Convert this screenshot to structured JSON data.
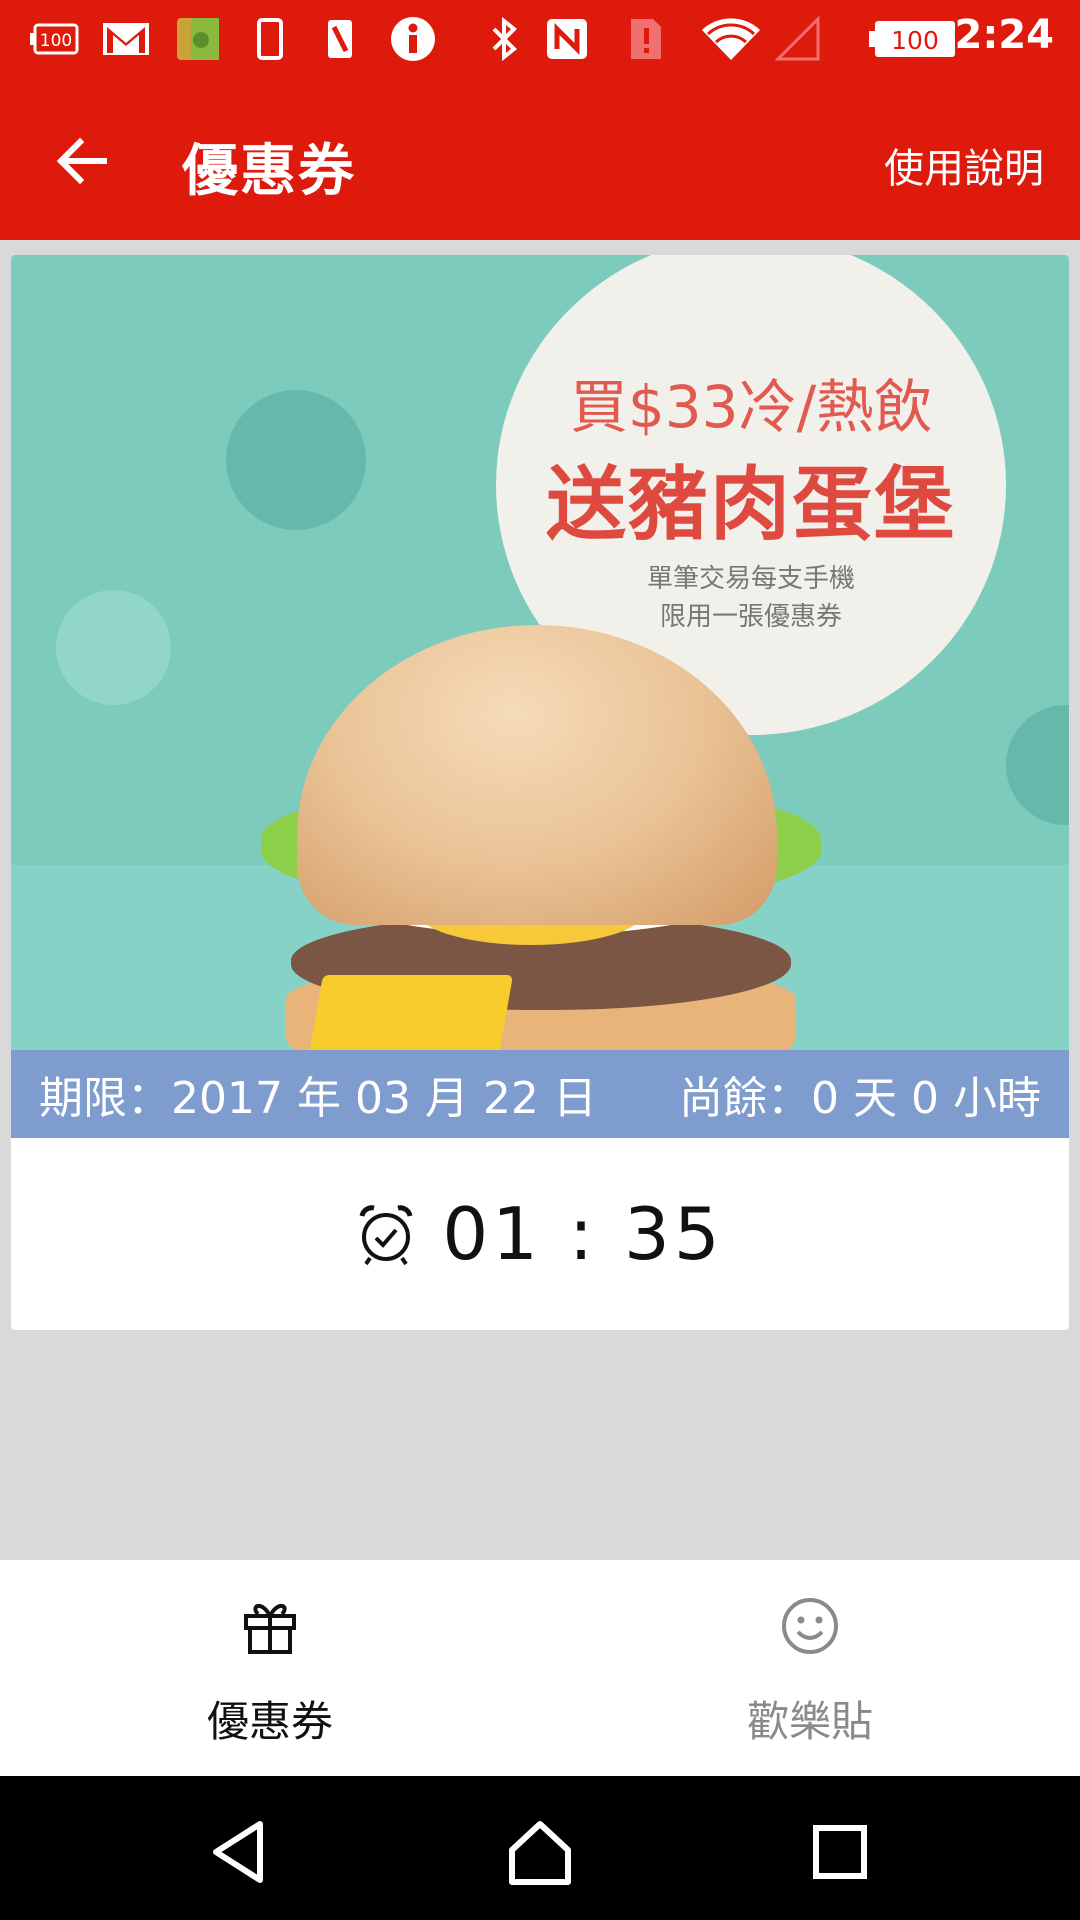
{
  "status_bar": {
    "time": "2:24",
    "battery_level": "100",
    "notification_badge": "100",
    "icons": [
      "battery-alert-icon",
      "gmail-icon",
      "app-icon",
      "phone-icon",
      "phone-rotate-icon",
      "info-icon",
      "bluetooth-icon",
      "nfc-icon",
      "sim-alert-icon",
      "wifi-icon",
      "signal-icon",
      "battery-icon"
    ]
  },
  "app_bar": {
    "title": "優惠券",
    "help_label": "使用說明",
    "back_icon": "arrow-left-icon"
  },
  "coupon": {
    "promo_line1": "買$33冷/熱飲",
    "promo_line2": "送豬肉蛋堡",
    "promo_note_line1": "單筆交易每支手機",
    "promo_note_line2": "限用一張優惠券",
    "expiry_label": "期限：2017 年 03 月 22 日",
    "remaining_label": "尚餘：0 天 0 小時",
    "timer": "01 : 35",
    "timer_icon": "alarm-clock-icon"
  },
  "tabs": [
    {
      "label": "優惠券",
      "icon": "gift-icon",
      "active": true
    },
    {
      "label": "歡樂貼",
      "icon": "smiley-icon",
      "active": false
    }
  ],
  "colors": {
    "brand_red": "#dd1a0c",
    "expiry_bar": "#7f9cce",
    "banner_teal": "#7ccbbd",
    "promo_text": "#de4a40",
    "tab_active": "#111111",
    "tab_inactive": "#8a8a8a"
  }
}
